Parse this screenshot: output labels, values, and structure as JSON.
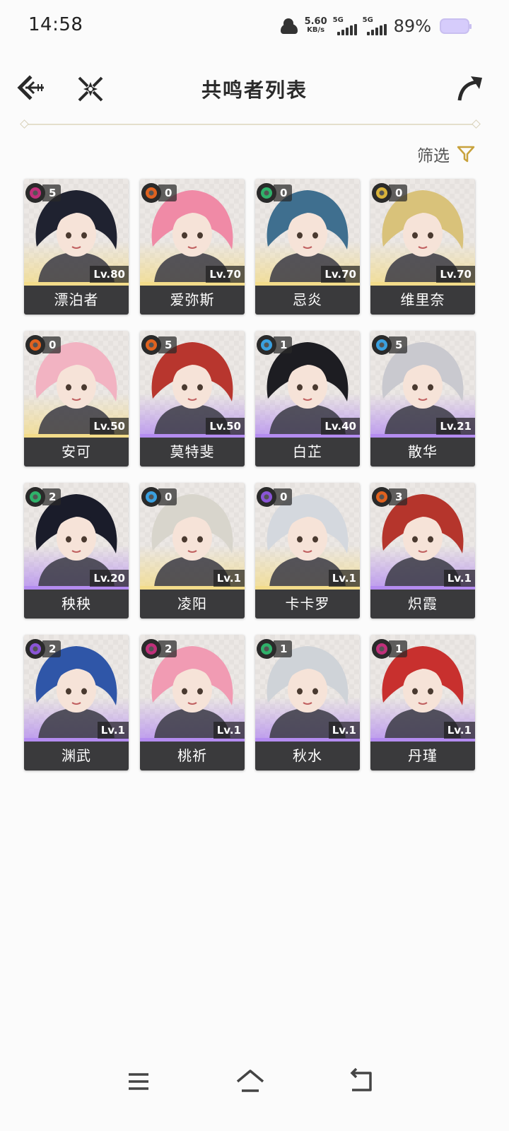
{
  "status_bar": {
    "time": "14:58",
    "net_speed_value": "5.60",
    "net_speed_unit": "KB/s",
    "signal1_label": "5G",
    "signal2_label": "5G",
    "battery_percent": "89%"
  },
  "header": {
    "title": "共鸣者列表",
    "back_icon": "back-arrow-icon",
    "mode_icon": "crossed-swords-icon",
    "share_icon": "share-arrow-icon"
  },
  "filter": {
    "label": "筛选",
    "icon": "funnel-icon"
  },
  "elements": {
    "havoc": "#c0307a",
    "fusion": "#e0621f",
    "aero": "#2fb26a",
    "spectro": "#d9b33a",
    "glacio": "#3aa0e0",
    "electro": "#8a55d6"
  },
  "rarity_colors": {
    "5": "#f3dc8a",
    "4": "#b48cf0"
  },
  "characters": [
    {
      "name": "漂泊者",
      "level": "Lv.80",
      "sequence": "5",
      "element": "havoc",
      "rarity": "5",
      "hair": "#1f2230"
    },
    {
      "name": "爱弥斯",
      "level": "Lv.70",
      "sequence": "0",
      "element": "fusion",
      "rarity": "5",
      "hair": "#f08aa6"
    },
    {
      "name": "忌炎",
      "level": "Lv.70",
      "sequence": "0",
      "element": "aero",
      "rarity": "5",
      "hair": "#3f6f8f"
    },
    {
      "name": "维里奈",
      "level": "Lv.70",
      "sequence": "0",
      "element": "spectro",
      "rarity": "5",
      "hair": "#d9c27a"
    },
    {
      "name": "安可",
      "level": "Lv.50",
      "sequence": "0",
      "element": "fusion",
      "rarity": "5",
      "hair": "#f2b3c2"
    },
    {
      "name": "莫特斐",
      "level": "Lv.50",
      "sequence": "5",
      "element": "fusion",
      "rarity": "4",
      "hair": "#b8362e"
    },
    {
      "name": "白芷",
      "level": "Lv.40",
      "sequence": "1",
      "element": "glacio",
      "rarity": "4",
      "hair": "#1d1d22"
    },
    {
      "name": "散华",
      "level": "Lv.21",
      "sequence": "5",
      "element": "glacio",
      "rarity": "4",
      "hair": "#c9c9cf"
    },
    {
      "name": "秧秧",
      "level": "Lv.20",
      "sequence": "2",
      "element": "aero",
      "rarity": "4",
      "hair": "#1a1c2a"
    },
    {
      "name": "凌阳",
      "level": "Lv.1",
      "sequence": "0",
      "element": "glacio",
      "rarity": "5",
      "hair": "#d8d5cc"
    },
    {
      "name": "卡卡罗",
      "level": "Lv.1",
      "sequence": "0",
      "element": "electro",
      "rarity": "5",
      "hair": "#d4d8de"
    },
    {
      "name": "炽霞",
      "level": "Lv.1",
      "sequence": "3",
      "element": "fusion",
      "rarity": "4",
      "hair": "#b5352c"
    },
    {
      "name": "渊武",
      "level": "Lv.1",
      "sequence": "2",
      "element": "electro",
      "rarity": "4",
      "hair": "#2f56a8"
    },
    {
      "name": "桃祈",
      "level": "Lv.1",
      "sequence": "2",
      "element": "havoc",
      "rarity": "4",
      "hair": "#f19bb3"
    },
    {
      "name": "秋水",
      "level": "Lv.1",
      "sequence": "1",
      "element": "aero",
      "rarity": "4",
      "hair": "#cfd3d8"
    },
    {
      "name": "丹瑾",
      "level": "Lv.1",
      "sequence": "1",
      "element": "havoc",
      "rarity": "4",
      "hair": "#c8302e"
    }
  ],
  "navbar": {
    "menu_icon": "menu-icon",
    "home_icon": "home-icon",
    "back_icon": "back-icon"
  }
}
